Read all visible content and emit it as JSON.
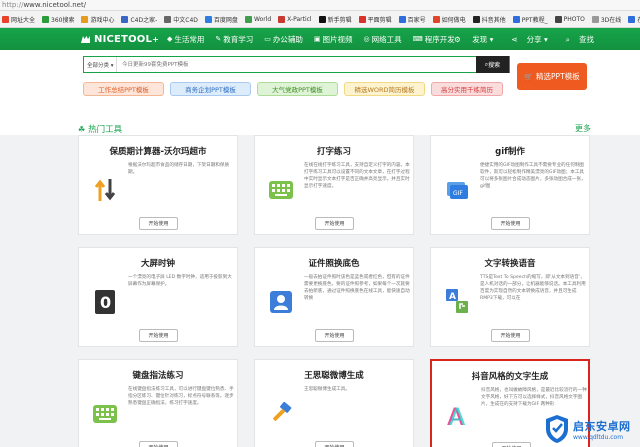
{
  "browser": {
    "url_scheme": "http://",
    "url_host": "www.nicetool.net/",
    "bookmarks": [
      {
        "label": "网址大全",
        "color": "#e8412c"
      },
      {
        "label": "360搜索",
        "color": "#2a9d3a"
      },
      {
        "label": "游戏中心",
        "color": "#e59b1d"
      },
      {
        "label": "C4D之家-",
        "color": "#3a66c5"
      },
      {
        "label": "中文C4D",
        "color": "#666666"
      },
      {
        "label": "百度网盘",
        "color": "#2f7de1"
      },
      {
        "label": "World",
        "color": "#3f9e4d"
      },
      {
        "label": "X-Particl",
        "color": "#c63a2f"
      },
      {
        "label": "新手剪辑",
        "color": "#111111"
      },
      {
        "label": "平面剪辑",
        "color": "#d8322a"
      },
      {
        "label": "百家号",
        "color": "#2f6ddc"
      },
      {
        "label": "如何做电",
        "color": "#e0452a"
      },
      {
        "label": "抖音其他",
        "color": "#222222"
      },
      {
        "label": "PPT教程_",
        "color": "#2f6ddc"
      },
      {
        "label": "PHOTO",
        "color": "#444444"
      },
      {
        "label": "3D在线",
        "color": "#999999"
      },
      {
        "label": "在线剪辑",
        "color": "#2f6ddc"
      },
      {
        "label": "抖音官方",
        "color": "#111111"
      }
    ]
  },
  "nav": {
    "logo": "NICETOOL",
    "logo_plus": "+",
    "items": [
      {
        "label": "生活常用",
        "icon": "◆"
      },
      {
        "label": "教育学习",
        "icon": "✎"
      },
      {
        "label": "办公辅助",
        "icon": "▭"
      },
      {
        "label": "图片视频",
        "icon": "▣"
      },
      {
        "label": "网络工具",
        "icon": "◎"
      },
      {
        "label": "程序开发",
        "icon": "⌨"
      }
    ],
    "right": [
      "发现 ▾",
      "分享 ▾",
      "查找"
    ],
    "right_icons": [
      "⚙",
      "⋖",
      "⌕"
    ]
  },
  "search": {
    "category": "全部分类 ▾",
    "placeholder": "今日更新99套免费PPT模板",
    "button": "搜索",
    "button_icon": "⌕"
  },
  "tags": [
    "工作总结PPT模板",
    "商务企划PPT模板",
    "大气党政PPT模板",
    "精选WORD简历模板",
    "高分实用千练简历"
  ],
  "promo": {
    "label": "精选PPT模板",
    "icon": "🛒"
  },
  "section": {
    "title": "热门工具",
    "more": "更多"
  },
  "use_label": "开始使用",
  "cards": [
    {
      "title": "保质期计算器-沃尔玛超市",
      "desc": "根据沃尔玛超市食品的储存日期，下架日期和保质期。",
      "icon": "arrows-icon"
    },
    {
      "title": "打字练习",
      "desc": "在线在线打字练习工具，支持自定义打字的内容。本打字练习工具可以设置不同的文本文章，在打字过程中实时显示文本打字是否正确并高亮显示。并且实时显示打字速度。",
      "icon": "keyboard-icon"
    },
    {
      "title": "gif制作",
      "desc": "便捷实用的GIF动图制作工具不需要专业的任何制图软件，就可以轻松制作精美漂亮的GIF动图；本工具可以将多张图片合成动态图片，多张动图合成一张，gif图",
      "icon": "gif-icon"
    },
    {
      "title": "大屏时钟",
      "desc": "一个漂亮的电子屏 LED 数字时钟，适用于投影到大屏幕作为屏幕保护。",
      "icon": "clock-icon"
    },
    {
      "title": "证件照换底色",
      "desc": "一般去拍证件照时该色是蓝色或者红色，但有的证件需要更换底色，要的证件照参考，如果每个一次就要去拍新底，通过证件照换底色在线工具，能快速自动转换",
      "icon": "idphoto-icon"
    },
    {
      "title": "文字转换语音",
      "desc": "TTS是Text To Speech的缩写，即'从文本到语音'，是人机对话的一部分，让机器能够说话。本工具利用百度为实现自然的文本转换成语音，并且可生成RMP3下载，可以在",
      "icon": "tts-icon"
    },
    {
      "title": "键盘指法练习",
      "desc": "在线键盘指法练习工具，可以进行键盘键位熟悉、手指分区练习、键位针对练习，标点符号联系等。逐步熟悉键盘正确指法，练习打字速度。",
      "icon": "keyboard-icon"
    },
    {
      "title": "王思聪微博生成",
      "desc": "王思聪微博生成工具。",
      "icon": "hammer-icon"
    },
    {
      "title": "抖音风格的文字生成",
      "desc": "抖音风格，也叫做故障风格，是最近比较流行的一种文字风格，好下方可以选择样式，抖音风格文字图片，生成在的支持下载为GIF 两种形",
      "icon": "tiktok-text-icon"
    }
  ],
  "watermark": {
    "line1": "启东安卓网",
    "line2": "www.qdltdu.com"
  }
}
